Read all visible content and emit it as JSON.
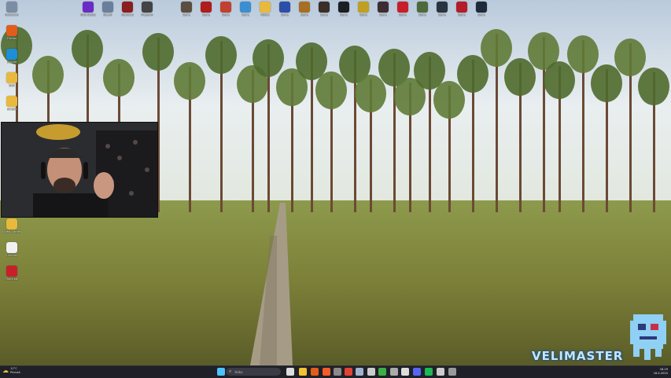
{
  "desktop": {
    "left_icons": [
      {
        "label": "Roskakori",
        "icon": "recycle-bin-icon",
        "color": "#7b8da3"
      },
      {
        "label": "Firefox",
        "icon": "firefox-icon",
        "color": "#e25c1a"
      },
      {
        "label": "Skriptit",
        "icon": "script-icon",
        "color": "#1c8fd8"
      },
      {
        "label": "AHK",
        "icon": "folder-icon",
        "color": "#e8b93c"
      },
      {
        "label": "Skriptit",
        "icon": "folder-icon",
        "color": "#e8b93c"
      },
      {
        "label": "Video Games",
        "icon": "folder-icon",
        "color": "#e8b93c"
      },
      {
        "label": "Uusi.txt",
        "icon": "text-file-icon",
        "color": "#f1f1f1"
      },
      {
        "label": "Shots.pdf",
        "icon": "pdf-file-icon",
        "color": "#c8202a"
      }
    ],
    "top_icons": [
      {
        "label": "OBS Studio",
        "icon": "obs-icon",
        "color": "#6b2cc6"
      },
      {
        "label": "Steam",
        "icon": "steam-icon",
        "color": "#6a7f9c"
      },
      {
        "label": "Shortcut",
        "icon": "shortcut-icon",
        "color": "#8b1e1e"
      },
      {
        "label": "Program",
        "icon": "app-icon",
        "color": "#444"
      },
      {
        "label": "Game",
        "icon": "game-icon",
        "color": "#5b4e3e"
      },
      {
        "label": "Game",
        "icon": "game-icon",
        "color": "#b01b1b"
      },
      {
        "label": "Game",
        "icon": "game-icon",
        "color": "#c2402f"
      },
      {
        "label": "Game",
        "icon": "game-icon",
        "color": "#3b8fd0"
      },
      {
        "label": "Folder",
        "icon": "folder-icon",
        "color": "#e8b93c"
      },
      {
        "label": "Game",
        "icon": "game-icon",
        "color": "#2b4fa8"
      },
      {
        "label": "Game",
        "icon": "game-icon",
        "color": "#a86e23"
      },
      {
        "label": "Game",
        "icon": "game-icon",
        "color": "#3b2d2a"
      },
      {
        "label": "Game",
        "icon": "game-icon",
        "color": "#1b1e23"
      },
      {
        "label": "Game",
        "icon": "game-icon",
        "color": "#c0a020"
      },
      {
        "label": "Game",
        "icon": "game-icon",
        "color": "#3d2c30"
      },
      {
        "label": "Game",
        "icon": "game-icon",
        "color": "#c81e2a"
      },
      {
        "label": "Game",
        "icon": "game-icon",
        "color": "#4d6a3d"
      },
      {
        "label": "Game",
        "icon": "game-icon",
        "color": "#283440"
      },
      {
        "label": "Game",
        "icon": "game-icon",
        "color": "#b41c28"
      },
      {
        "label": "Game",
        "icon": "game-icon",
        "color": "#1c2a3c"
      }
    ]
  },
  "watermark": {
    "text": "VELIMASTER"
  },
  "taskbar": {
    "weather_temp": "12°C",
    "weather_desc": "Pilvistä",
    "search_placeholder": "Haku",
    "apps": [
      {
        "icon": "windows-start-icon",
        "color": "#4cc2ff"
      },
      {
        "icon": "task-view-icon",
        "color": "#dddddd"
      },
      {
        "icon": "file-explorer-icon",
        "color": "#f2c230"
      },
      {
        "icon": "firefox-icon",
        "color": "#e25c1a"
      },
      {
        "icon": "brave-icon",
        "color": "#f45c2a"
      },
      {
        "icon": "calculator-icon",
        "color": "#8a8a8a"
      },
      {
        "icon": "chrome-icon",
        "color": "#e34133"
      },
      {
        "icon": "steam-icon",
        "color": "#9eb3cf"
      },
      {
        "icon": "terminal-icon",
        "color": "#cccccc"
      },
      {
        "icon": "xbox-icon",
        "color": "#3cb043"
      },
      {
        "icon": "settings-icon",
        "color": "#aaaaaa"
      },
      {
        "icon": "obs-icon",
        "color": "#dddddd"
      },
      {
        "icon": "discord-icon",
        "color": "#5865f2"
      },
      {
        "icon": "spotify-icon",
        "color": "#1db954"
      },
      {
        "icon": "gamepad-icon",
        "color": "#cccccc"
      },
      {
        "icon": "app-icon",
        "color": "#999999"
      }
    ],
    "clock_time": "18.29",
    "clock_date": "16.4.2025"
  }
}
